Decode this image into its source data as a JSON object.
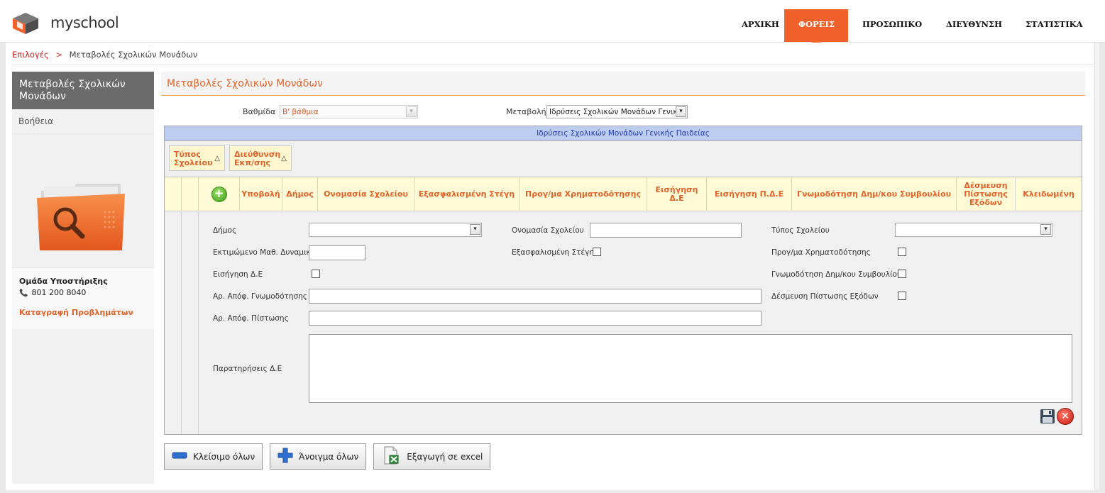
{
  "header": {
    "logo_text": "myschool",
    "nav": [
      {
        "label": "ΑΡΧΙΚΗ",
        "active": false
      },
      {
        "label": "ΦΟΡΕΙΣ",
        "active": true
      },
      {
        "label": "ΠΡΟΣΩΠΙΚΟ",
        "active": false
      },
      {
        "label": "ΔΙΕΥΘΥΝΣΗ",
        "active": false
      },
      {
        "label": "ΣΤΑΤΙΣΤΙΚΑ",
        "active": false
      }
    ],
    "accent_color": "#f0612b"
  },
  "breadcrumb": {
    "root": "Επιλογές",
    "separator": ">",
    "current": "Μεταβολές Σχολικών Μονάδων"
  },
  "sidebar": {
    "title": "Μεταβολές Σχολικών Μονάδων",
    "help": "Βοήθεια",
    "icon": "folder-search-icon",
    "support_title": "Ομάδα Υποστήριξης",
    "support_phone": "801 200 8040",
    "report_link": "Καταγραφή Προβλημάτων"
  },
  "main": {
    "title": "Μεταβολές Σχολικών Μονάδων",
    "filters": {
      "level_label": "Βαθμίδα",
      "level_value": "Β' βάθμια",
      "change_label": "Μεταβολή",
      "change_value": "Ιδρύσεις Σχολικών Μονάδων Γενικής Π"
    },
    "grid": {
      "caption": "Ιδρύσεις Σχολικών Μονάδων Γενικής Παιδείας",
      "group_by": [
        {
          "label": "Τύπος Σχολείου",
          "sort": "△"
        },
        {
          "label": "Διεύθυνση Εκπ/σης",
          "sort": "△"
        }
      ],
      "add_symbol": "+",
      "columns": [
        "Υποβολή",
        "Δήμος",
        "Ονομασία Σχολείου",
        "Εξασφαλισμένη Στέγη",
        "Προγ/μα Χρηματοδότησης",
        "Εισήγηση Δ.Ε",
        "Εισήγηση Π.Δ.Ε",
        "Γνωμοδότηση Δημ/κου Συμβουλίου",
        "Δέσμευση Πίστωσης Εξόδων",
        "Κλειδωμένη"
      ]
    },
    "form": {
      "municipality_label": "Δήμος",
      "municipality_value": "",
      "school_name_label": "Ονομασία Σχολείου",
      "school_name_value": "",
      "school_type_label": "Τύπος Σχολείου",
      "school_type_value": "",
      "students_label": "Εκτιμώμενο Μαθ. Δυναμικό",
      "students_value": "",
      "housing_label": "Εξασφαλισμένη Στέγη",
      "housing_checked": false,
      "funding_label": "Προγ/μα Χρηματοδότησης",
      "funding_checked": false,
      "de_proposal_label": "Εισήγηση Δ.Ε",
      "de_proposal_checked": false,
      "council_label": "Γνωμοδότηση Δημ/κου Συμβουλίου",
      "council_checked": false,
      "opinion_no_label": "Αρ. Απόφ. Γνωμοδότησης",
      "opinion_no_value": "",
      "credit_label": "Δέσμευση Πίστωσης Εξόδων",
      "credit_checked": false,
      "credit_no_label": "Αρ. Απόφ. Πίστωσης",
      "credit_no_value": "",
      "notes_label": "Παρατηρήσεις Δ.Ε",
      "notes_value": "",
      "cancel_symbol": "✕"
    },
    "actions": {
      "collapse_all": "Κλείσιμο όλων",
      "expand_all": "Άνοιγμα όλων",
      "export_excel": "Εξαγωγή σε excel"
    }
  }
}
